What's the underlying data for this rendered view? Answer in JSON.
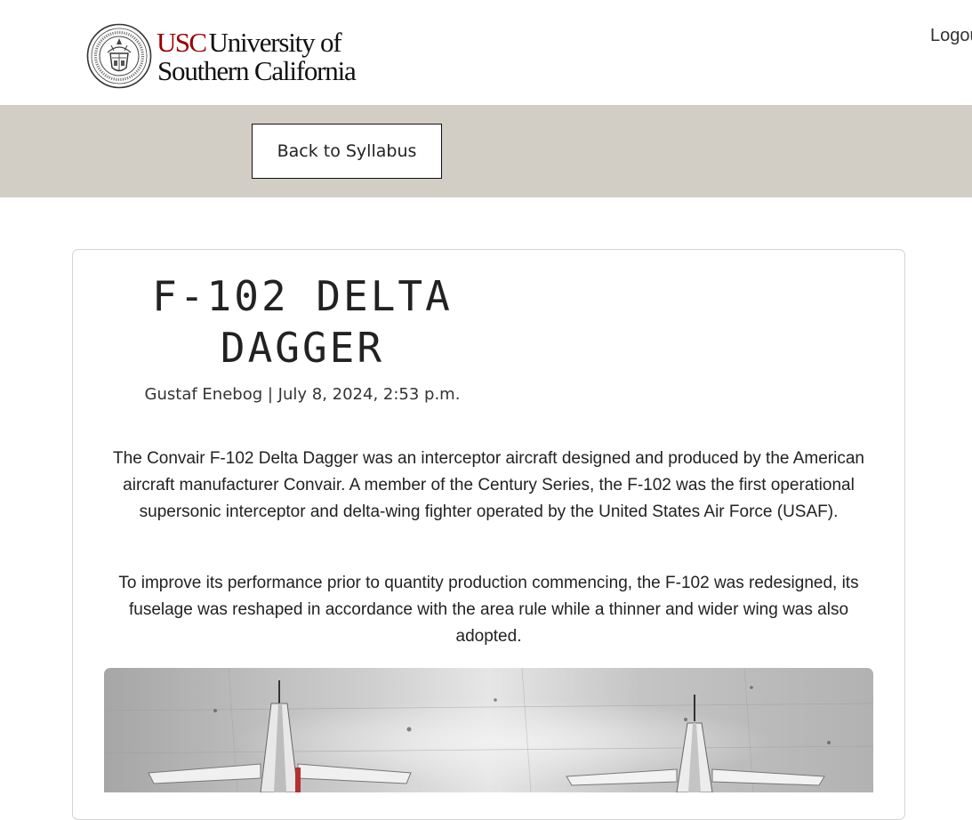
{
  "header": {
    "logo_usc": "USC",
    "logo_line1": "University of",
    "logo_line2": "Southern California",
    "logout": "Logout"
  },
  "nav": {
    "back_label": "Back to Syllabus"
  },
  "post": {
    "title": "F-102 DELTA DAGGER",
    "meta": "Gustaf Enebog | July 8, 2024, 2:53 p.m.",
    "paragraphs": [
      "The Convair F-102 Delta Dagger was an interceptor aircraft designed and produced by the American aircraft manufacturer Convair. A member of the Century Series, the F-102 was the first operational supersonic interceptor and delta-wing fighter operated by the United States Air Force (USAF).",
      "To improve its performance prior to quantity production commencing, the F-102 was redesigned, its fuselage was reshaped in accordance with the area rule while a thinner and wider wing was also adopted."
    ]
  },
  "colors": {
    "brand_red": "#990000",
    "nav_band": "#d2cec5"
  },
  "icons": {
    "seal": "usc-seal-icon"
  }
}
